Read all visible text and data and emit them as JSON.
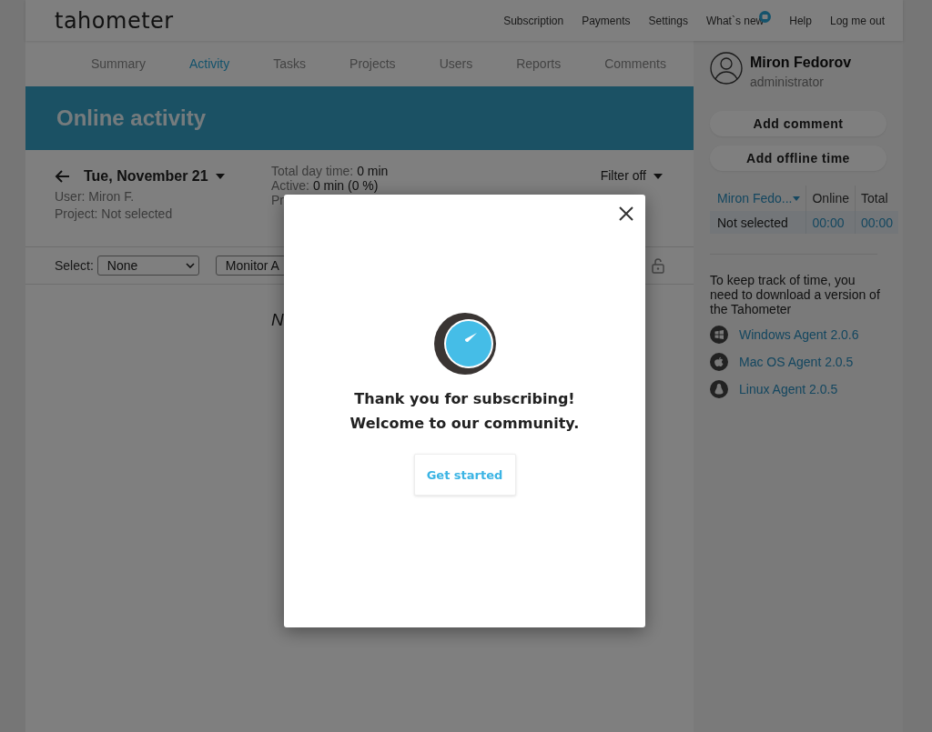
{
  "header": {
    "logo": "tahometer",
    "nav": [
      {
        "label": "Subscription",
        "kind": "link"
      },
      {
        "label": "Payments",
        "kind": "link"
      },
      {
        "label": "Settings",
        "kind": "link"
      },
      {
        "label": "What`s new",
        "kind": "news"
      },
      {
        "label": "Help",
        "kind": "link"
      },
      {
        "label": "Log me out",
        "kind": "link"
      }
    ]
  },
  "tabs": [
    {
      "label": "Summary",
      "selected": false
    },
    {
      "label": "Activity",
      "selected": true
    },
    {
      "label": "Tasks",
      "selected": false
    },
    {
      "label": "Projects",
      "selected": false
    },
    {
      "label": "Users",
      "selected": false
    },
    {
      "label": "Reports",
      "selected": false
    },
    {
      "label": "Comments",
      "selected": false
    }
  ],
  "banner": {
    "title": "Online activity"
  },
  "day": {
    "date": "Tue, November 21",
    "user": "User: Miron F.",
    "project": "Project: Not selected",
    "stats": [
      {
        "label": "Total day time:",
        "value": "0 min"
      },
      {
        "label": "Active:",
        "value": "0 min (0 %)"
      },
      {
        "label": "Pr"
      }
    ],
    "filter": "Filter off"
  },
  "toolbar": {
    "select_label": "Select:",
    "select_value": "None",
    "monitor": "Monitor A"
  },
  "content": {
    "message": "N"
  },
  "sidebar": {
    "user": {
      "name": "Miron Fedorov",
      "role": "administrator"
    },
    "buttons": [
      "Add comment",
      "Add offline time"
    ],
    "table": {
      "columns": [
        "Miron Fedo...",
        "Online",
        "Total"
      ],
      "rows": [
        [
          "Not selected",
          "00:00",
          "00:00"
        ]
      ]
    },
    "note": "To keep track of time, you need to download a version of the Tahometer",
    "downloads": [
      {
        "kind": "windows",
        "label": "Windows Agent 2.0.6"
      },
      {
        "kind": "mac",
        "label": "Mac OS Agent 2.0.5"
      },
      {
        "kind": "linux",
        "label": "Linux Agent 2.0.5"
      }
    ]
  },
  "modal": {
    "lines": [
      "Thank you for subscribing!",
      "Welcome to our community."
    ],
    "button": "Get started"
  }
}
